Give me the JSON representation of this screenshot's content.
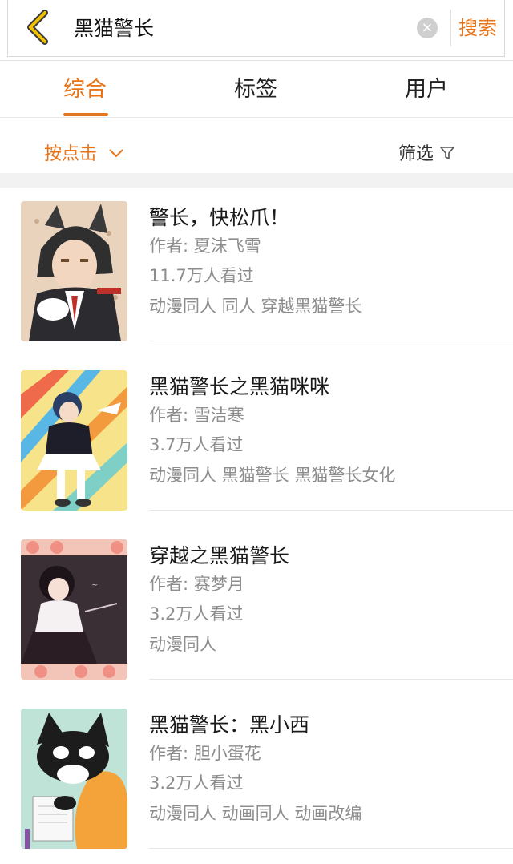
{
  "search": {
    "query": "黑猫警长",
    "clear_glyph": "×",
    "submit_label": "搜索"
  },
  "tabs": [
    {
      "label": "综合",
      "active": true
    },
    {
      "label": "标签",
      "active": false
    },
    {
      "label": "用户",
      "active": false
    }
  ],
  "filters": {
    "sort_label": "按点击",
    "filter_label": "筛选"
  },
  "colors": {
    "accent": "#e8741a",
    "meta_text": "#8d8d8d",
    "separator": "#f2f2f2"
  },
  "results": [
    {
      "title": "警长，快松爪！",
      "author": "作者: 夏沫飞雪",
      "views": "11.7万人看过",
      "tags": "动漫同人  同人  穿越黑猫警长"
    },
    {
      "title": "黑猫警长之黑猫咪咪",
      "author": "作者: 雪洁寒",
      "views": "3.7万人看过",
      "tags": "动漫同人  黑猫警长  黑猫警长女化"
    },
    {
      "title": "穿越之黑猫警长",
      "author": "作者: 赛梦月",
      "views": "3.2万人看过",
      "tags": "动漫同人"
    },
    {
      "title": "黑猫警长：黑小西",
      "author": "作者: 胆小蛋花",
      "views": "3.2万人看过",
      "tags": "动漫同人  动画同人  动画改编"
    }
  ]
}
